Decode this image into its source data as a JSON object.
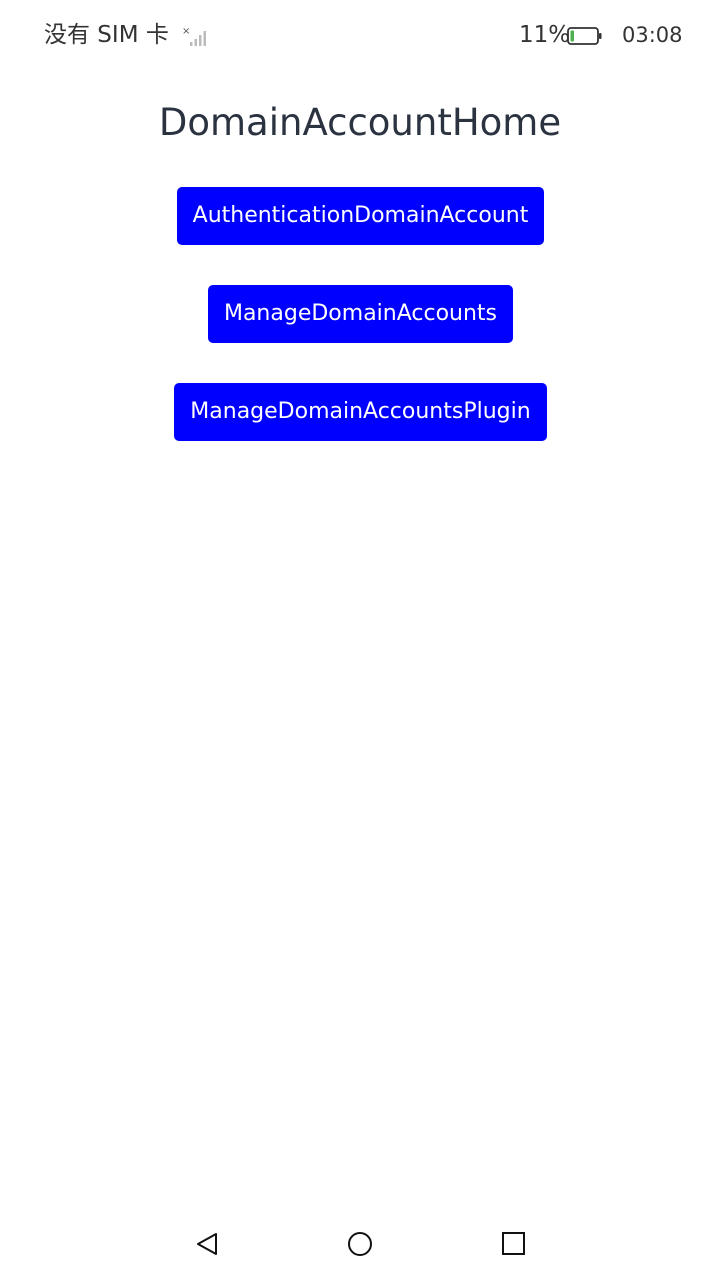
{
  "status_bar": {
    "carrier": "没有 SIM 卡",
    "battery_percent": "11%",
    "time": "03:08",
    "icons": [
      "signal-icon",
      "battery-icon"
    ]
  },
  "page": {
    "title": "DomainAccountHome"
  },
  "buttons": [
    {
      "label": "AuthenticationDomainAccount"
    },
    {
      "label": "ManageDomainAccounts"
    },
    {
      "label": "ManageDomainAccountsPlugin"
    }
  ],
  "nav_bar": {
    "icons": [
      "back-icon",
      "home-icon",
      "recent-apps-icon"
    ]
  },
  "colors": {
    "button_background": "#0000ff",
    "button_text": "#ffffff",
    "title_text": "#2b3340",
    "battery_fill": "#4caf50"
  }
}
